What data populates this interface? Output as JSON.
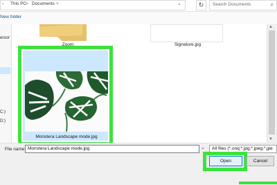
{
  "address": {
    "crumbs": [
      "This PC",
      "Documents"
    ],
    "separator": ">"
  },
  "search": {
    "placeholder": "Search Documents"
  },
  "toolbar": {
    "new_folder": "New folder"
  },
  "nav": {
    "items": [
      "ersor",
      "C:)",
      "D:)"
    ]
  },
  "files": [
    {
      "name": "Zoom"
    },
    {
      "name": "Signature.jpg"
    },
    {
      "name": "Monstera Landscape mode.jpg",
      "selected": true
    }
  ],
  "footer": {
    "file_name_label": "File name:",
    "file_name_value": "Monstera Landscape mode.jpg",
    "file_type_value": "All files (*.onq;*.jpg;*.jpeg;*.jpe",
    "open_label": "Open",
    "cancel_label": "Cancel"
  },
  "colors": {
    "highlight": "#3ee23e",
    "selection": "#cce8ff",
    "accent": "#0078d7"
  }
}
